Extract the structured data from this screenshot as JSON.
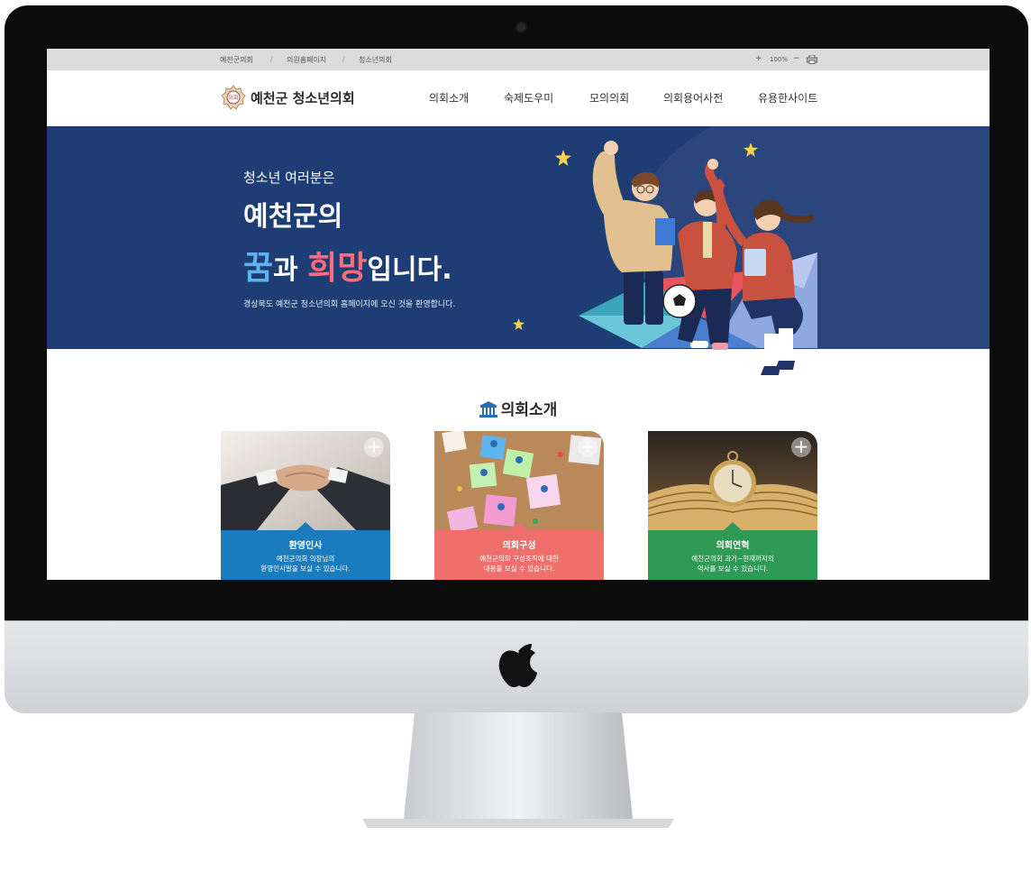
{
  "topbar": {
    "links": [
      "예천군의회",
      "의원홈페이지",
      "청소년의회"
    ],
    "separator": "/",
    "zoom_in": "+",
    "zoom_level": "100%",
    "zoom_out": "−"
  },
  "header": {
    "logo_text": "예천군 청소년의회",
    "logo_seal_text": "의회",
    "nav": [
      "의회소개",
      "숙제도우미",
      "모의의회",
      "의회용어사전",
      "유용한사이트"
    ]
  },
  "hero": {
    "line1": "청소년 여러분은",
    "line2": "예천군의",
    "line3_hl1": "꿈",
    "line3_mid": "과 ",
    "line3_hl2": "희망",
    "line3_end": "입니다.",
    "desc": "경상북도 예천군 청소년의회 홈페이지에 오신 것을 환영합니다."
  },
  "section": {
    "title": "의회소개",
    "icon": "building-icon"
  },
  "cards": [
    {
      "title": "환영인사",
      "desc1": "예천군의회 의장님의",
      "desc2": "환영인사말을 보실 수 있습니다.",
      "color": "#1a7bbd",
      "plus": "+"
    },
    {
      "title": "의회구성",
      "desc1": "예천군의회 구성조직에 대한",
      "desc2": "내용을 보실 수 있습니다.",
      "color": "#ef6f6c",
      "plus": "+"
    },
    {
      "title": "의회연혁",
      "desc1": "예천군의회 과거~현재까지의",
      "desc2": "역사를 보실 수 있습니다.",
      "color": "#2f9a55",
      "plus": "+"
    }
  ],
  "colors": {
    "hero_bg": "#1f3d75",
    "accent_blue": "#5db3f0",
    "accent_pink": "#ff6d7d"
  }
}
